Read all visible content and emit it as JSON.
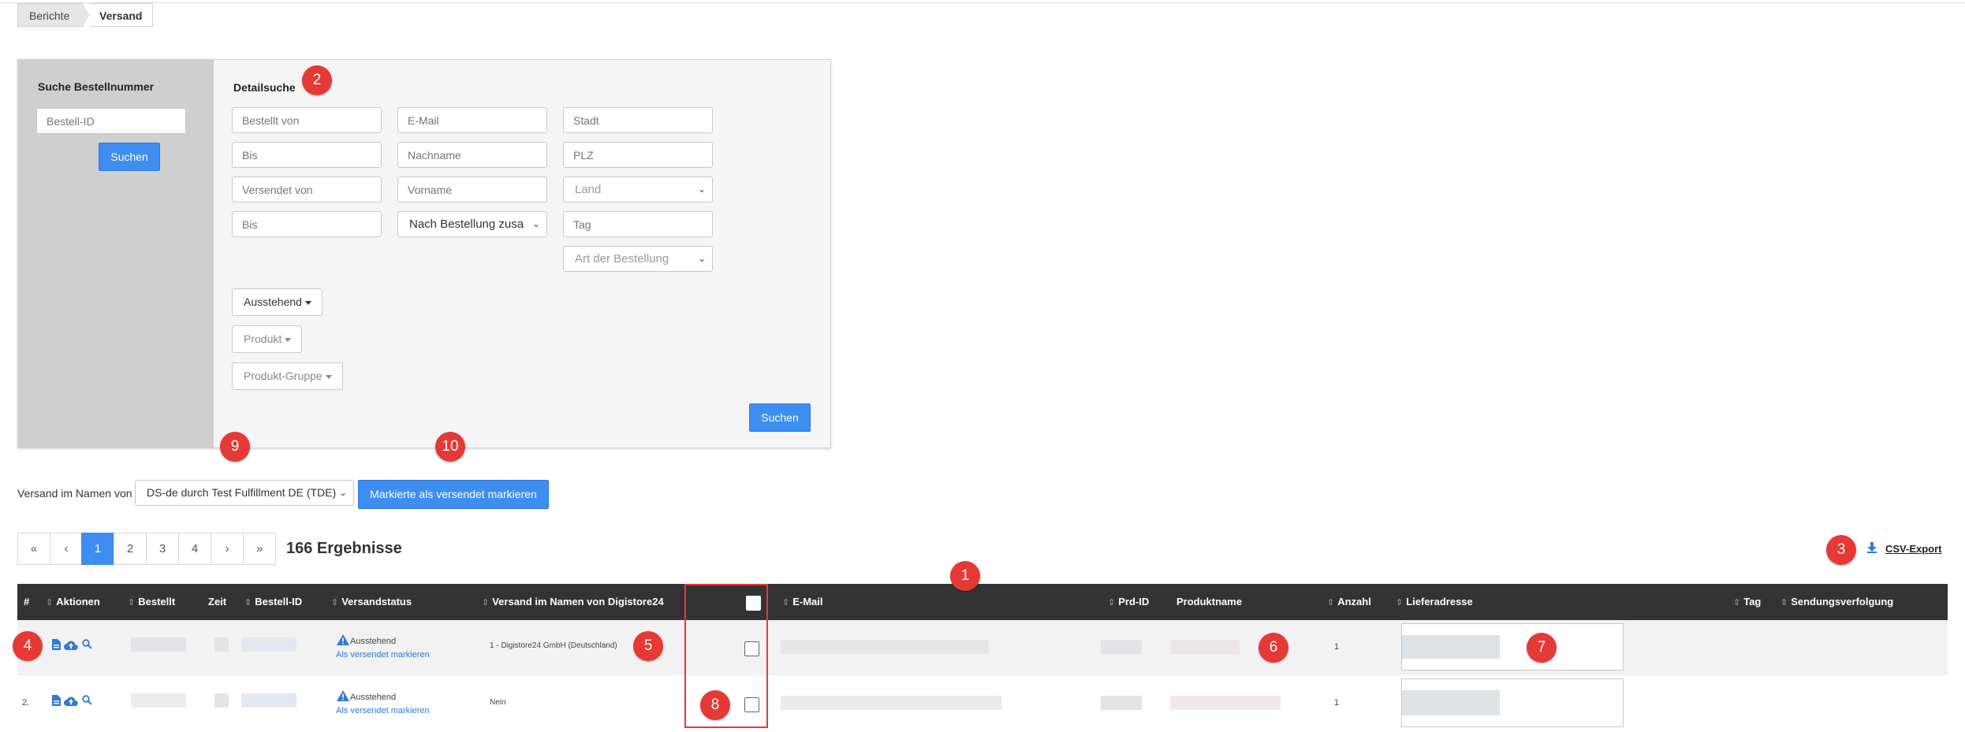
{
  "breadcrumb": {
    "items": [
      "Berichte",
      "Versand"
    ]
  },
  "order_search": {
    "title": "Suche Bestellnummer",
    "id_placeholder": "Bestell-ID",
    "search_label": "Suchen"
  },
  "detail_search": {
    "title": "Detailsuche",
    "fields": {
      "ordered_from": "Bestellt von",
      "ordered_to": "Bis",
      "shipped_from": "Versendet von",
      "shipped_to": "Bis",
      "email": "E-Mail",
      "lastname": "Nachname",
      "firstname": "Vorname",
      "city": "Stadt",
      "zip": "PLZ",
      "tag": "Tag"
    },
    "selects": {
      "summary": "Nach Bestellung zusa",
      "country": "Land",
      "order_type": "Art der Bestellung"
    },
    "dropdowns": {
      "status": "Ausstehend",
      "product": "Produkt",
      "product_group": "Produkt-Gruppe"
    },
    "search_label": "Suchen"
  },
  "ship_as": {
    "label": "Versand im Namen von",
    "selected": "DS-de durch Test Fulfillment DE (TDE)",
    "mark_button": "Markierte als versendet markieren"
  },
  "pagination": {
    "first": "«",
    "prev": "‹",
    "pages": [
      "1",
      "2",
      "3",
      "4"
    ],
    "current": "1",
    "next": "›",
    "last": "»",
    "results": "166 Ergebnisse"
  },
  "export": {
    "label": "CSV-Export",
    "icon": "download-icon"
  },
  "table": {
    "columns": {
      "num": "#",
      "actions": "Aktionen",
      "ordered": "Bestellt",
      "time": "Zeit",
      "order_id": "Bestell-ID",
      "status": "Versandstatus",
      "ship_name": "Versand im Namen von Digistore24",
      "email": "E-Mail",
      "prd_id": "Prd-ID",
      "product": "Produktname",
      "qty": "Anzahl",
      "address": "Lieferadresse",
      "tag": "Tag",
      "tracking": "Sendungsverfolgung"
    },
    "rows": [
      {
        "num": "",
        "status": "Ausstehend",
        "mark_link": "Als versendet markieren",
        "ship_name": "1 - Digistore24 GmbH (Deutschland)",
        "qty": "1"
      },
      {
        "num": "2.",
        "status": "Ausstehend",
        "mark_link": "Als versendet markieren",
        "ship_name": "Nein",
        "qty": "1"
      }
    ]
  },
  "badges": {
    "b1": "1",
    "b2": "2",
    "b3": "3",
    "b4": "4",
    "b5": "5",
    "b6": "6",
    "b7": "7",
    "b8": "8",
    "b9": "9",
    "b10": "10"
  },
  "colors": {
    "accent": "#3d8ef0",
    "header_bg": "#333333",
    "badge": "#e53935",
    "highlight_border": "#e53935"
  }
}
